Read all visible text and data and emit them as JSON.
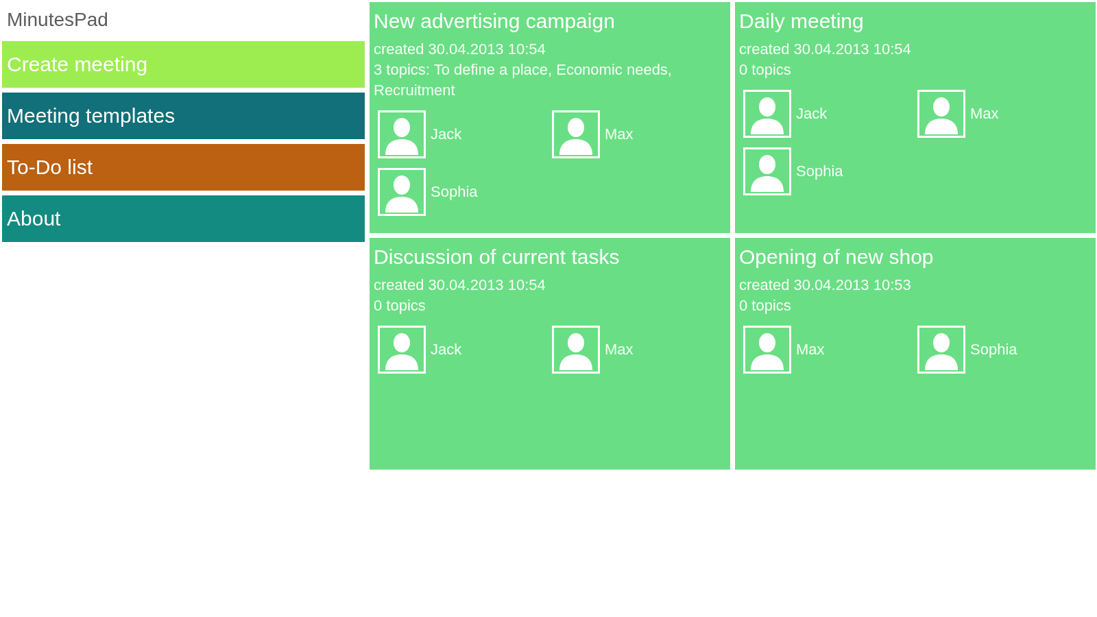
{
  "app": {
    "title": "MinutesPad"
  },
  "menu": [
    {
      "label": "Create meeting",
      "color": "#9ded50"
    },
    {
      "label": "Meeting templates",
      "color": "#11707a"
    },
    {
      "label": "To-Do list",
      "color": "#bb6111"
    },
    {
      "label": "About",
      "color": "#138b80"
    }
  ],
  "meetings": [
    {
      "title": "New advertising campaign",
      "created": "created 30.04.2013 10:54",
      "topics": "3 topics: To define a place, Economic needs, Recruitment",
      "participants": [
        {
          "name": "Jack"
        },
        {
          "name": "Max"
        },
        {
          "name": "Sophia"
        }
      ]
    },
    {
      "title": "Daily meeting",
      "created": "created 30.04.2013 10:54",
      "topics": "0 topics",
      "participants": [
        {
          "name": "Jack"
        },
        {
          "name": "Max"
        },
        {
          "name": "Sophia"
        }
      ]
    },
    {
      "title": "Discussion of current tasks",
      "created": "created 30.04.2013 10:54",
      "topics": "0 topics",
      "participants": [
        {
          "name": "Jack"
        },
        {
          "name": "Max"
        }
      ]
    },
    {
      "title": "Opening of new shop",
      "created": "created 30.04.2013 10:53",
      "topics": "0 topics",
      "participants": [
        {
          "name": "Max"
        },
        {
          "name": "Sophia"
        }
      ]
    }
  ]
}
